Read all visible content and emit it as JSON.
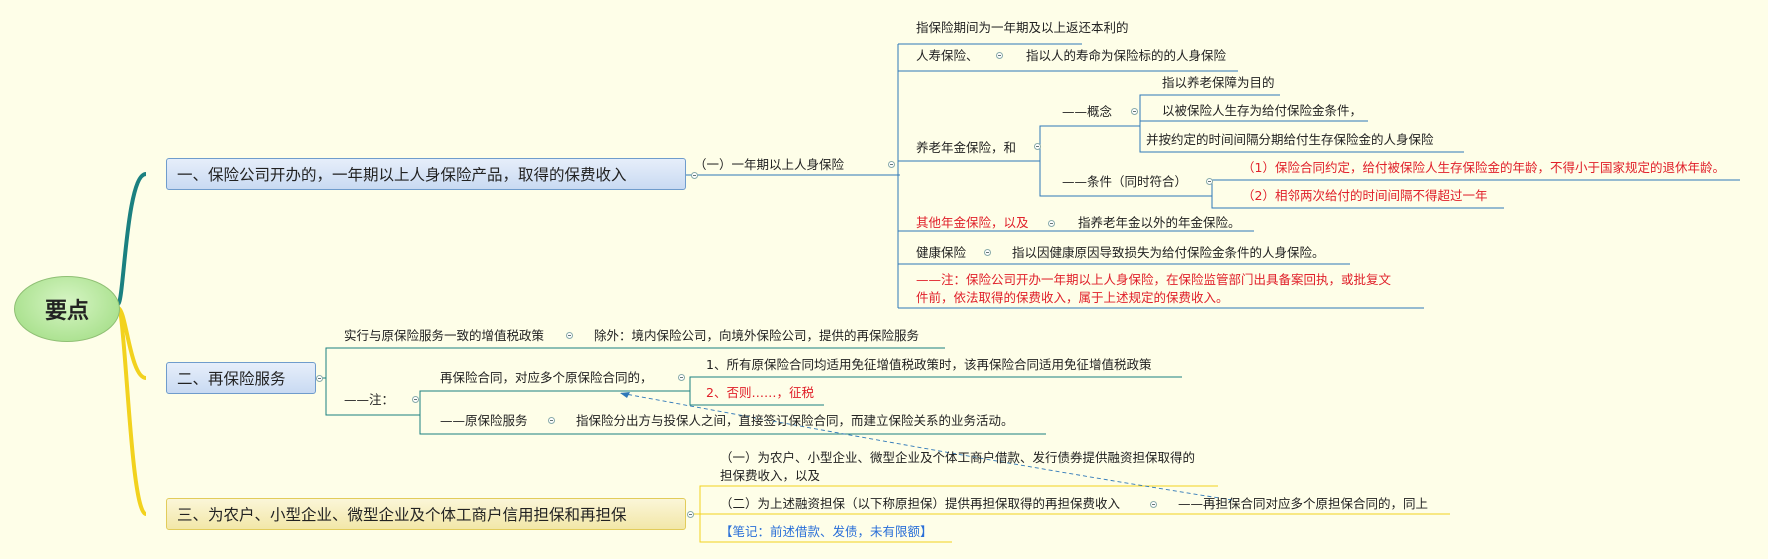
{
  "root": {
    "label": "要点"
  },
  "branch1": {
    "title": "一、保险公司开办的，一年期以上人身保险产品，取得的保费收入",
    "sub": "（一）一年期以上人身保险",
    "definition": "指保险期间为一年期及以上返还本利的",
    "life": {
      "label": "人寿保险、",
      "desc": "指以人的寿命为保险标的的人身保险"
    },
    "pension": {
      "label": "养老年金保险，和",
      "concept_label": "——概念",
      "concept_items": [
        "指以养老保障为目的",
        "以被保险人生存为给付保险金条件，",
        "并按约定的时间间隔分期给付生存保险金的人身保险"
      ],
      "condition_label": "——条件（同时符合）",
      "condition_items": [
        "（1）保险合同约定，给付被保险人生存保险金的年龄，不得小于国家规定的退休年龄。",
        "（2）相邻两次给付的时间间隔不得超过一年"
      ]
    },
    "other": {
      "label": "其他年金保险，以及",
      "desc": "指养老年金以外的年金保险。"
    },
    "health": {
      "label": "健康保险",
      "desc": "指以因健康原因导致损失为给付保险金条件的人身保险。"
    },
    "note": [
      "——注：保险公司开办一年期以上人身保险，在保险监管部门出具备案回执，或批复文",
      "件前，依法取得的保费收入，属于上述规定的保费收入。"
    ]
  },
  "branch2": {
    "title": "二、再保险服务",
    "item1": "实行与原保险服务一致的增值税政策",
    "item1_exception": "除外：境内保险公司，向境外保险公司，提供的再保险服务",
    "note_label": "——注：",
    "reins_contract": "再保险合同，对应多个原保险合同的，",
    "reins_rule1": "1、所有原保险合同均适用免征增值税政策时，该再保险合同适用免征增值税政策",
    "reins_rule2": "2、否则……，征税",
    "orig_label": "——原保险服务",
    "orig_desc": "指保险分出方与投保人之间，直接签订保险合同，而建立保险关系的业务活动。"
  },
  "branch3": {
    "title": "三、为农户、小型企业、微型企业及个体工商户信用担保和再担保",
    "item1": [
      "（一）为农户、小型企业、微型企业及个体工商户借款、发行债券提供融资担保取得的",
      "担保费收入，以及"
    ],
    "item2": "（二）为上述融资担保（以下称原担保）提供再担保取得的再担保费收入",
    "item2_note": "——再担保合同对应多个原担保合同的，同上",
    "memo": "【笔记：前述借款、发债，未有限额】"
  },
  "colors": {
    "teal": "#1b8080",
    "yellow": "#f2d21e",
    "blue_line": "#2f78b8",
    "red_text": "#e0202a",
    "memo_blue": "#2a6fd8"
  }
}
